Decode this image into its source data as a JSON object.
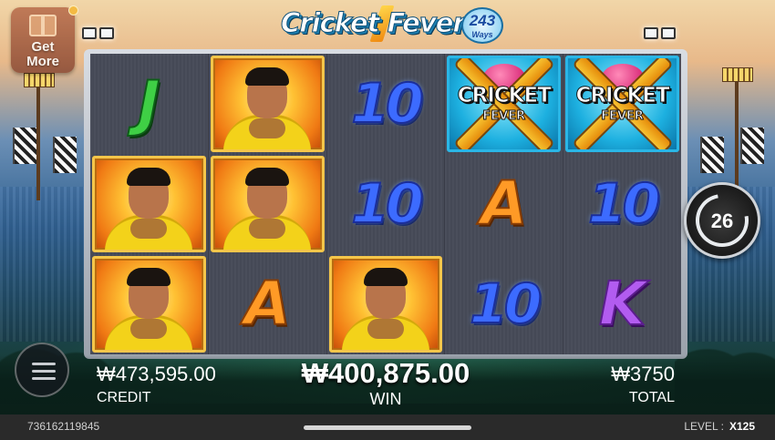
{
  "header": {
    "get_more_label": "Get\nMore",
    "logo_name": "Cricket Fever",
    "logo_ways_count": "243",
    "logo_ways_label": "Ways"
  },
  "reels": [
    [
      "J",
      "player",
      "player"
    ],
    [
      "player",
      "player",
      "A"
    ],
    [
      "10",
      "10",
      "player"
    ],
    [
      "cricket_fever",
      "A",
      "10"
    ],
    [
      "cricket_fever",
      "10",
      "K"
    ]
  ],
  "symbols": {
    "cricket_fever_line1": "CRICKET",
    "cricket_fever_line2": "FEVER"
  },
  "spin_button": {
    "free_spins_remaining": "26"
  },
  "footer": {
    "credit_value": "₩473,595.00",
    "credit_label": "CREDIT",
    "win_value": "₩400,875.00",
    "win_label": "WIN",
    "total_value": "₩3750",
    "total_label": "TOTAL",
    "session_id": "736162119845",
    "level_label": "LEVEL :",
    "level_value": "X125"
  },
  "icons": {
    "menu": "hamburger-icon",
    "spin": "refresh-arrow-icon",
    "get_more": "gift-icon"
  },
  "colors": {
    "ten_symbol": "#3c6bff",
    "jack_symbol": "#3fcf45",
    "ace_symbol": "#ff9a26",
    "king_symbol": "#b25cf0",
    "player_frame": "#f5c64a",
    "logo_frame": "#2ab6e6"
  }
}
